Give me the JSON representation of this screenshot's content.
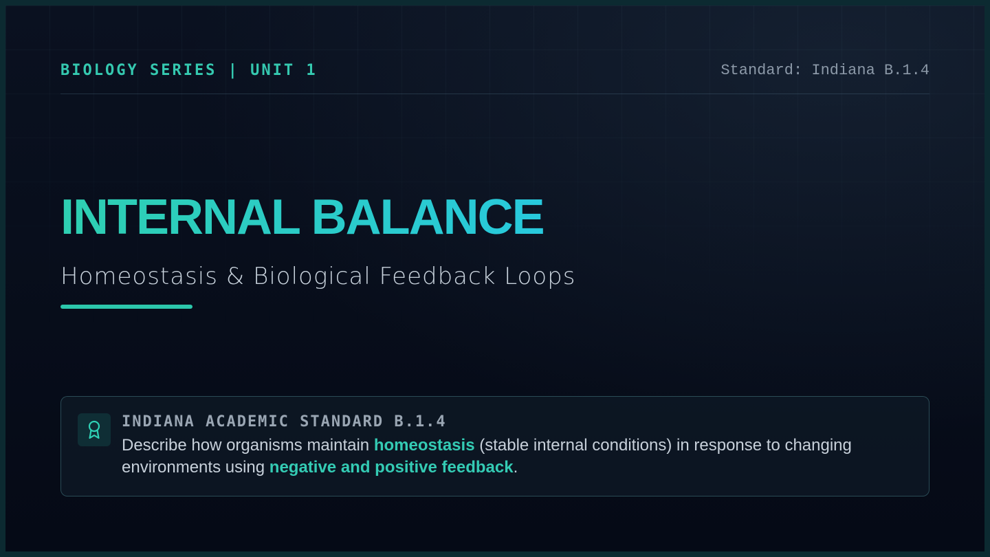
{
  "header": {
    "series_label": "BIOLOGY SERIES | UNIT 1",
    "standard_label": "Standard: Indiana B.1.4"
  },
  "hero": {
    "title": "INTERNAL BALANCE",
    "subtitle": "Homeostasis & Biological Feedback Loops"
  },
  "standard_card": {
    "icon": "award-icon",
    "heading": "INDIANA ACADEMIC STANDARD B.1.4",
    "body_part1": "Describe how organisms maintain ",
    "highlight1": "homeostasis",
    "body_part2": " (stable internal conditions) in response to changing environments using ",
    "highlight2": "negative and positive feedback",
    "body_part3": "."
  },
  "colors": {
    "accent": "#2cc7ab",
    "accent_cyan": "#28c9dd",
    "background": "#050a16",
    "text_muted": "#8c99a8"
  }
}
